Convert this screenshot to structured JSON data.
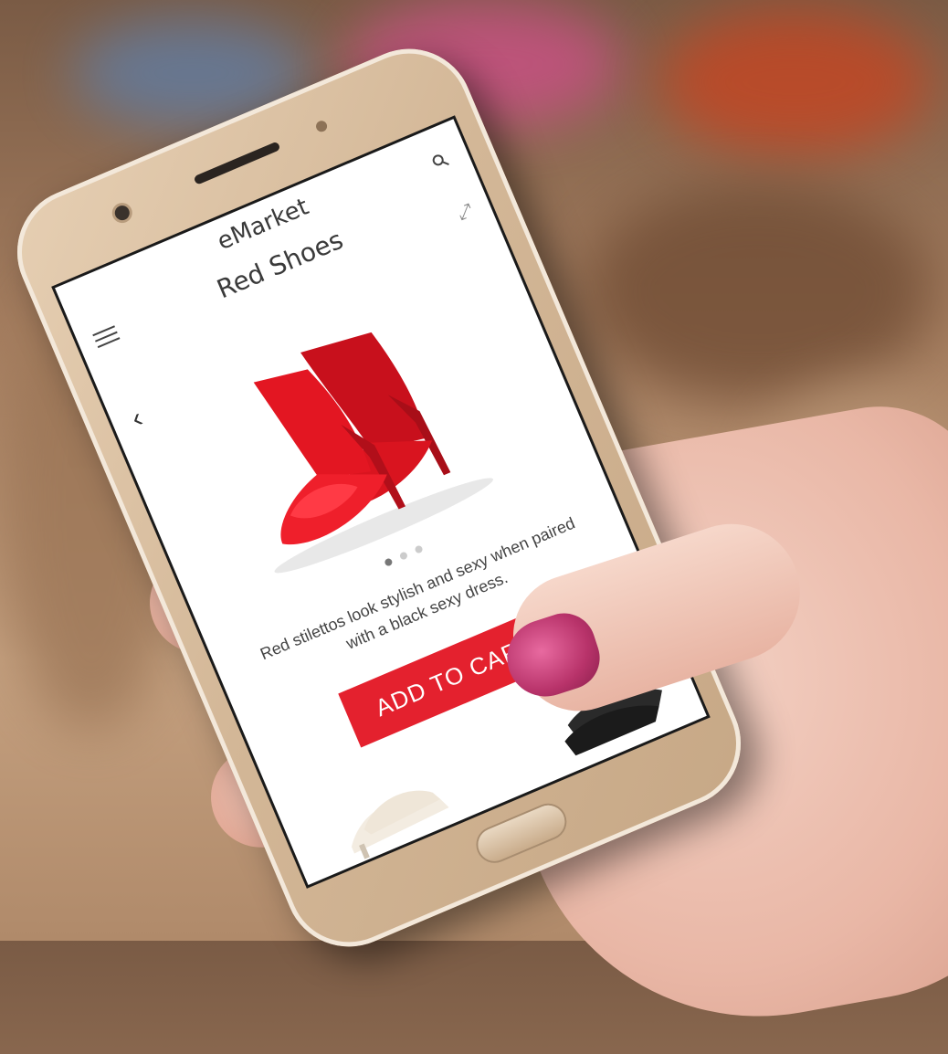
{
  "colors": {
    "accent": "#e4212e",
    "phone_body": "#d3b797",
    "screen_bg": "#ffffff"
  },
  "app": {
    "title": "eMarket"
  },
  "header": {
    "menu_icon": "hamburger-menu-icon",
    "search_icon": "search-icon",
    "cart_icon": "shopping-cart-icon"
  },
  "product": {
    "title": "Red Shoes",
    "image_alt": "red-stiletto-shoes",
    "description": "Red stilettos look stylish and sexy when paired with a black sexy dress.",
    "carousel": {
      "count": 3,
      "active": 1
    }
  },
  "actions": {
    "add_to_cart_label": "ADD TO CART"
  },
  "icons": {
    "back": "chevron-left-icon",
    "expand": "expand-icon"
  }
}
